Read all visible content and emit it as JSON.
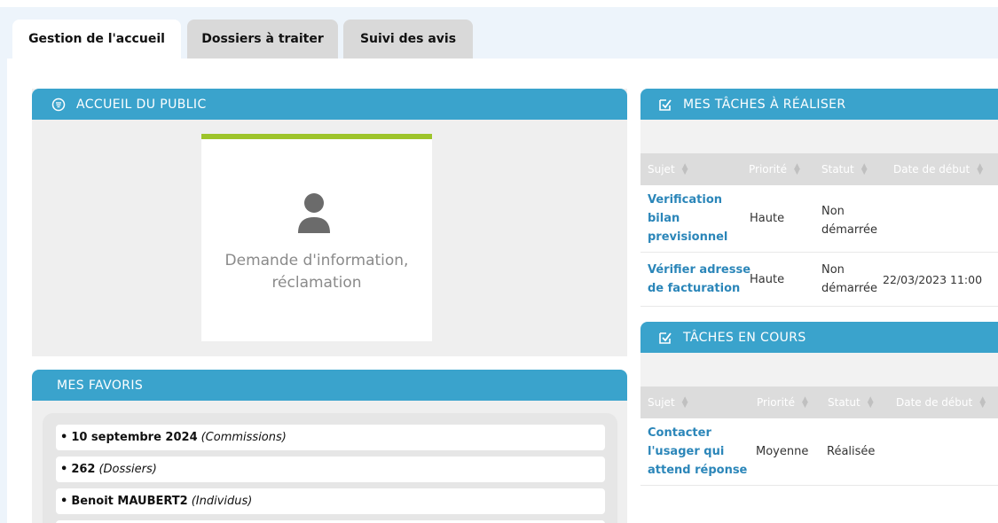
{
  "tabs": [
    {
      "label": "Gestion de l'accueil",
      "active": true
    },
    {
      "label": "Dossiers à traiter",
      "active": false
    },
    {
      "label": "Suivi des avis",
      "active": false
    }
  ],
  "accueil": {
    "title": "ACCUEIL DU PUBLIC",
    "card_line1": "Demande d'information,",
    "card_line2": "réclamation"
  },
  "favoris": {
    "title": "MES FAVORIS",
    "items": [
      {
        "name": "10 septembre 2024",
        "type": "(Commissions)"
      },
      {
        "name": "262",
        "type": "(Dossiers)"
      },
      {
        "name": "Benoit MAUBERT2",
        "type": "(Individus)"
      }
    ]
  },
  "taches": {
    "title": "MES TÂCHES À RÉALISER",
    "columns": [
      "Sujet",
      "Priorité",
      "Statut",
      "Date de début"
    ],
    "rows": [
      {
        "sujet": [
          "Verification",
          "bilan",
          "previsionnel"
        ],
        "priorite": "Haute",
        "statut": [
          "Non",
          "démarrée"
        ],
        "date": ""
      },
      {
        "sujet": [
          "Vérifier adresse",
          "de facturation"
        ],
        "priorite": "Haute",
        "statut": [
          "Non",
          "démarrée"
        ],
        "date": "22/03/2023 11:00"
      }
    ]
  },
  "encours": {
    "title": "TÂCHES EN COURS",
    "columns": [
      "Sujet",
      "Priorité",
      "Statut",
      "Date de début"
    ],
    "rows": [
      {
        "sujet": [
          "Contacter",
          "l'usager qui",
          "attend réponse"
        ],
        "priorite": "Moyenne",
        "statut": [
          "Réalisée"
        ],
        "date": ""
      }
    ]
  },
  "colors": {
    "header": "#3aa3cc",
    "accent_green": "#9dc42a",
    "link": "#2b86b9"
  }
}
